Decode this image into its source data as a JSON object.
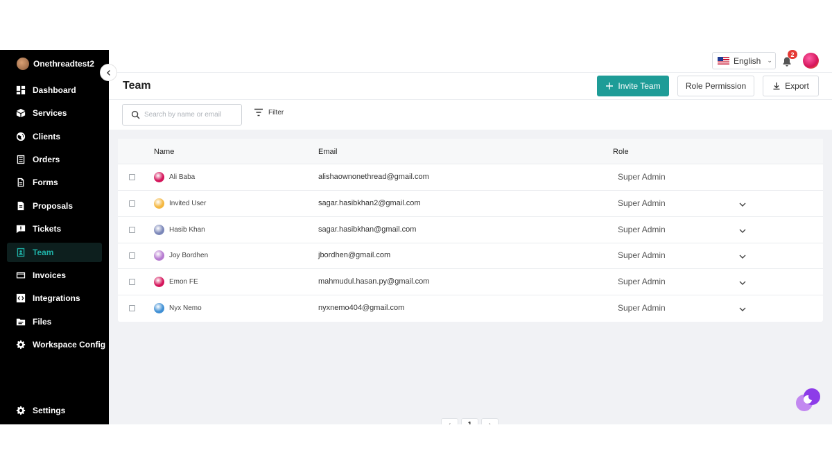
{
  "workspace": {
    "name": "Onethreadtest2"
  },
  "sidebar": {
    "items": [
      {
        "label": "Dashboard",
        "icon": "dashboard-icon"
      },
      {
        "label": "Services",
        "icon": "box-icon"
      },
      {
        "label": "Clients",
        "icon": "globe-icon"
      },
      {
        "label": "Orders",
        "icon": "list-icon"
      },
      {
        "label": "Forms",
        "icon": "document-icon"
      },
      {
        "label": "Proposals",
        "icon": "proposal-icon"
      },
      {
        "label": "Tickets",
        "icon": "ticket-icon"
      },
      {
        "label": "Team",
        "icon": "team-icon",
        "active": true
      },
      {
        "label": "Invoices",
        "icon": "card-icon"
      },
      {
        "label": "Integrations",
        "icon": "puzzle-icon"
      },
      {
        "label": "Files",
        "icon": "folder-icon"
      },
      {
        "label": "Workspace Config",
        "icon": "gear-config-icon"
      }
    ],
    "settings_label": "Settings"
  },
  "topbar": {
    "language": "English",
    "notification_count": "2"
  },
  "header": {
    "title": "Team",
    "invite_label": "Invite Team",
    "role_permission_label": "Role Permission",
    "export_label": "Export"
  },
  "toolbar": {
    "search_placeholder": "Search by name or email",
    "filter_label": "Filter"
  },
  "table": {
    "columns": {
      "name": "Name",
      "email": "Email",
      "role": "Role"
    },
    "rows": [
      {
        "name": "Ali Baba",
        "email": "alishaownonethread@gmail.com",
        "role": "Super Admin",
        "dropdown": false,
        "avatar_color": "#d4145a"
      },
      {
        "name": "Invited User",
        "email": "sagar.hasibkhan2@gmail.com",
        "role": "Super Admin",
        "dropdown": true,
        "avatar_color": "#f4b740"
      },
      {
        "name": "Hasib Khan",
        "email": "sagar.hasibkhan@gmail.com",
        "role": "Super Admin",
        "dropdown": true,
        "avatar_color": "#7a86b8"
      },
      {
        "name": "Joy Bordhen",
        "email": "jbordhen@gmail.com",
        "role": "Super Admin",
        "dropdown": true,
        "avatar_color": "#b67ad0"
      },
      {
        "name": "Emon FE",
        "email": "mahmudul.hasan.py@gmail.com",
        "role": "Super Admin",
        "dropdown": true,
        "avatar_color": "#d4145a"
      },
      {
        "name": "Nyx Nemo",
        "email": "nyxnemo404@gmail.com",
        "role": "Super Admin",
        "dropdown": true,
        "avatar_color": "#3f8fd4"
      }
    ]
  },
  "pagination": {
    "current": "1"
  }
}
